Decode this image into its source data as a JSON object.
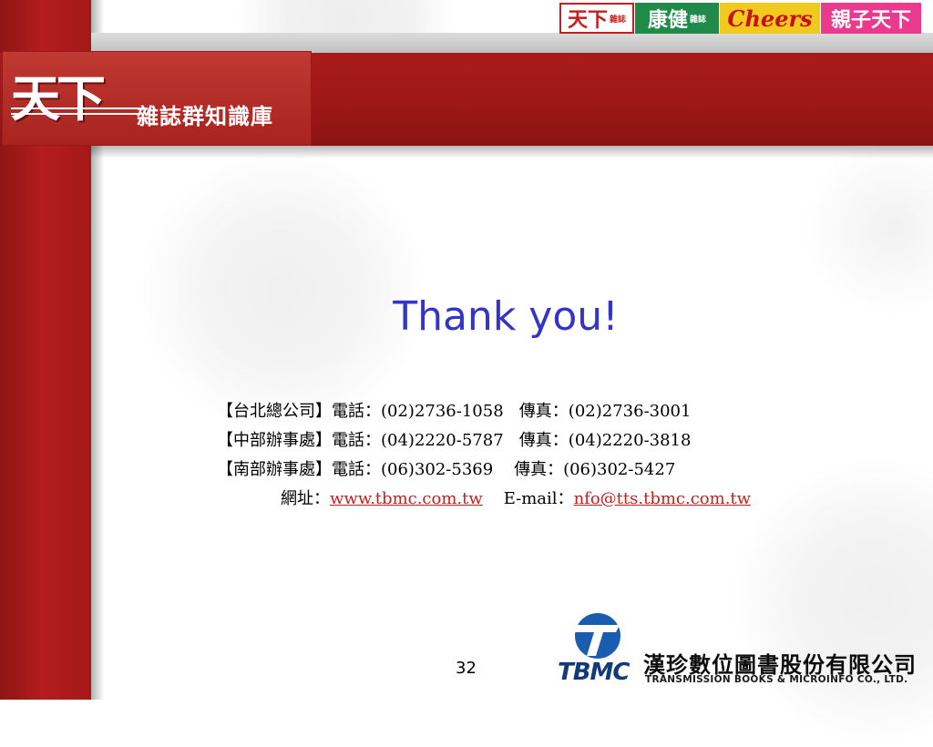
{
  "header": {
    "logo_big": "天下",
    "logo_sub": "雜誌群知識庫",
    "badges": [
      {
        "name": "天下",
        "tag": "雜誌"
      },
      {
        "name": "康健",
        "tag": "雜誌"
      },
      {
        "name": "Cheers"
      },
      {
        "name": "親子天下"
      }
    ]
  },
  "slide": {
    "title": "Thank you!",
    "contacts": [
      "【台北總公司】電話：(02)2736-1058   傳真：(02)2736-3001",
      "【中部辦事處】電話：(04)2220-5787   傳真：(04)2220-3818",
      "【南部辦事處】電話：(06)302-5369    傳真：(06)302-5427"
    ],
    "website_label": "網址：",
    "website_url": "www.tbmc.com.tw",
    "email_label": "E-mail：",
    "email": "nfo@tts.tbmc.com.tw"
  },
  "footer": {
    "page_number": "32",
    "brand": "TBMC",
    "company_zh": "漢珍數位圖書股份有限公司",
    "company_en": "TRANSMISSION BOOKS & MICROINFO CO., LTD."
  },
  "colors": {
    "brand_red": "#a91b1b",
    "title_blue": "#3434c8",
    "link_red": "#c41f1f",
    "tbmc_blue": "#1a5db0"
  }
}
